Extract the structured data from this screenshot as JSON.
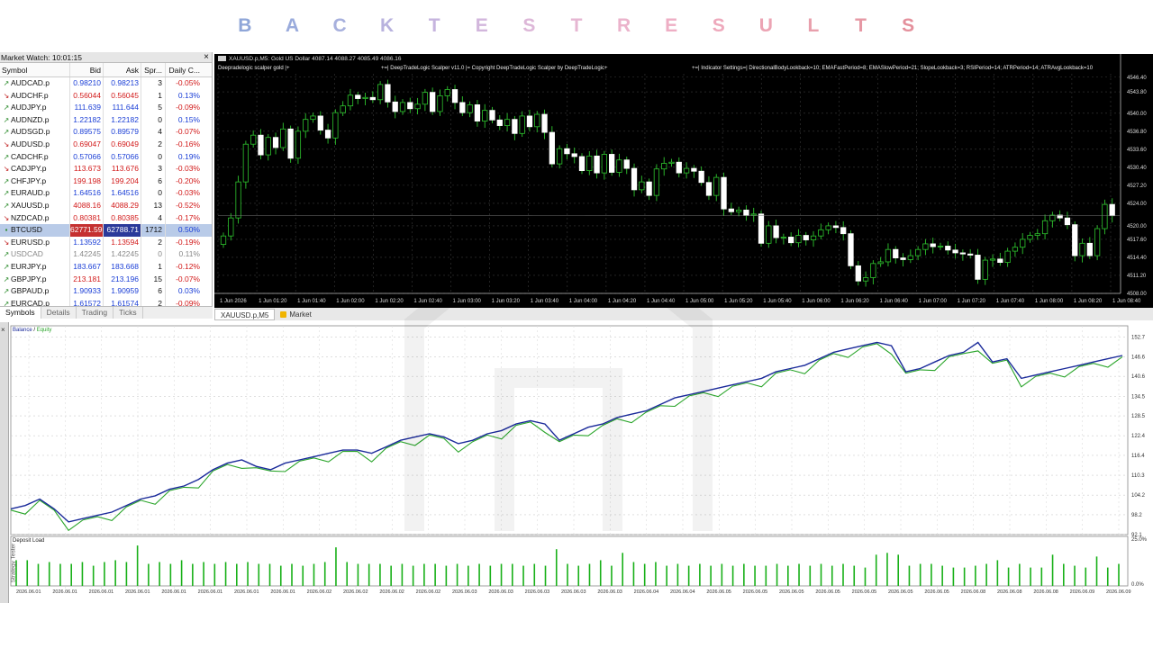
{
  "banner": {
    "letters": [
      "B",
      "A",
      "C",
      "K",
      "T",
      "E",
      "S",
      "T",
      "R",
      "E",
      "S",
      "U",
      "L",
      "T",
      "S"
    ],
    "colors": [
      "#8fa6d8",
      "#9aabdc",
      "#a7b0dd",
      "#b8b2de",
      "#c6b4de",
      "#d2b6dc",
      "#ddb7d8",
      "#e6b6d2",
      "#ebb3cb",
      "#eeaec4",
      "#eea9bc",
      "#eca4b4",
      "#e89fac",
      "#e698a4",
      "#e4909c"
    ]
  },
  "market_watch": {
    "title": "Market Watch: 10:01:15",
    "close": "×",
    "columns": [
      "Symbol",
      "Bid",
      "Ask",
      "Spr...",
      "Daily C..."
    ],
    "rows": [
      {
        "symbol": "AUDCAD.p",
        "bid": "0.98210",
        "ask": "0.98213",
        "spread": "3",
        "change": "-0.05%",
        "dir": "up",
        "bid_color": "blue",
        "ask_color": "blue",
        "change_color": "red"
      },
      {
        "symbol": "AUDCHF.p",
        "bid": "0.56044",
        "ask": "0.56045",
        "spread": "1",
        "change": "0.13%",
        "dir": "dn",
        "bid_color": "red",
        "ask_color": "red",
        "change_color": "blue"
      },
      {
        "symbol": "AUDJPY.p",
        "bid": "111.639",
        "ask": "111.644",
        "spread": "5",
        "change": "-0.09%",
        "dir": "up",
        "bid_color": "blue",
        "ask_color": "blue",
        "change_color": "red"
      },
      {
        "symbol": "AUDNZD.p",
        "bid": "1.22182",
        "ask": "1.22182",
        "spread": "0",
        "change": "0.15%",
        "dir": "up",
        "bid_color": "blue",
        "ask_color": "blue",
        "change_color": "blue"
      },
      {
        "symbol": "AUDSGD.p",
        "bid": "0.89575",
        "ask": "0.89579",
        "spread": "4",
        "change": "-0.07%",
        "dir": "up",
        "bid_color": "blue",
        "ask_color": "blue",
        "change_color": "red"
      },
      {
        "symbol": "AUDUSD.p",
        "bid": "0.69047",
        "ask": "0.69049",
        "spread": "2",
        "change": "-0.16%",
        "dir": "dn",
        "bid_color": "red",
        "ask_color": "red",
        "change_color": "red"
      },
      {
        "symbol": "CADCHF.p",
        "bid": "0.57066",
        "ask": "0.57066",
        "spread": "0",
        "change": "0.19%",
        "dir": "up",
        "bid_color": "blue",
        "ask_color": "blue",
        "change_color": "blue"
      },
      {
        "symbol": "CADJPY.p",
        "bid": "113.673",
        "ask": "113.676",
        "spread": "3",
        "change": "-0.03%",
        "dir": "dn",
        "bid_color": "red",
        "ask_color": "red",
        "change_color": "red"
      },
      {
        "symbol": "CHFJPY.p",
        "bid": "199.198",
        "ask": "199.204",
        "spread": "6",
        "change": "-0.20%",
        "dir": "up",
        "bid_color": "red",
        "ask_color": "red",
        "change_color": "red"
      },
      {
        "symbol": "EURAUD.p",
        "bid": "1.64516",
        "ask": "1.64516",
        "spread": "0",
        "change": "-0.03%",
        "dir": "up",
        "bid_color": "blue",
        "ask_color": "blue",
        "change_color": "red"
      },
      {
        "symbol": "XAUUSD.p",
        "bid": "4088.16",
        "ask": "4088.29",
        "spread": "13",
        "change": "-0.52%",
        "dir": "up",
        "bid_color": "red",
        "ask_color": "red",
        "change_color": "red"
      },
      {
        "symbol": "NZDCAD.p",
        "bid": "0.80381",
        "ask": "0.80385",
        "spread": "4",
        "change": "-0.17%",
        "dir": "dn",
        "bid_color": "red",
        "ask_color": "red",
        "change_color": "red"
      },
      {
        "symbol": "BTCUSD",
        "bid": "62771.59",
        "ask": "62788.71",
        "spread": "1712",
        "change": "0.50%",
        "dir": "sel",
        "bid_color": "red",
        "ask_color": "blue",
        "change_color": "blue",
        "selected": true
      },
      {
        "symbol": "EURUSD.p",
        "bid": "1.13592",
        "ask": "1.13594",
        "spread": "2",
        "change": "-0.19%",
        "dir": "dn",
        "bid_color": "blue",
        "ask_color": "red",
        "change_color": "red"
      },
      {
        "symbol": "USDCAD",
        "bid": "1.42245",
        "ask": "1.42245",
        "spread": "0",
        "change": "0.11%",
        "dir": "up",
        "bid_color": "blue",
        "ask_color": "blue",
        "change_color": "blue",
        "muted": true
      },
      {
        "symbol": "EURJPY.p",
        "bid": "183.667",
        "ask": "183.668",
        "spread": "1",
        "change": "-0.12%",
        "dir": "up",
        "bid_color": "blue",
        "ask_color": "blue",
        "change_color": "red"
      },
      {
        "symbol": "GBPJPY.p",
        "bid": "213.181",
        "ask": "213.196",
        "spread": "15",
        "change": "-0.07%",
        "dir": "up",
        "bid_color": "red",
        "ask_color": "blue",
        "change_color": "red"
      },
      {
        "symbol": "GBPAUD.p",
        "bid": "1.90933",
        "ask": "1.90959",
        "spread": "6",
        "change": "0.03%",
        "dir": "up",
        "bid_color": "blue",
        "ask_color": "blue",
        "change_color": "blue"
      },
      {
        "symbol": "EURCAD.p",
        "bid": "1.61572",
        "ask": "1.61574",
        "spread": "2",
        "change": "-0.09%",
        "dir": "up",
        "bid_color": "blue",
        "ask_color": "blue",
        "change_color": "red"
      }
    ],
    "tabs": [
      "Symbols",
      "Details",
      "Trading",
      "Ticks"
    ]
  },
  "chart": {
    "title": "XAUUSD.p,M5:  Gold US Dollar  4087.14 4088.27 4085.49 4086.16",
    "info_left": "Deepradelogic scalper gold |+",
    "info_mid": "+=| DeepTradeLogic Scalper v11.0 |=  Copyright DeepTradeLogic Scalper by DeepTradeLogic+",
    "info_right": "+=| Indicator Settings=| DirectionalBodyLookback=10; EMAFastPeriod=8; EMASlowPeriod=21; SlopeLookback=3; RSIPeriod=14; ATRPeriod=14; ATRAvgLookback=10",
    "price_labels": [
      "4546.40",
      "4543.80",
      "4540.00",
      "4536.80",
      "4533.60",
      "4530.40",
      "4527.20",
      "4524.00",
      "4520.00",
      "4517.60",
      "4514.40",
      "4511.20",
      "4508.00"
    ],
    "time_labels": [
      "1 Jun 2026",
      "1 Jun 01:20",
      "1 Jun 01:40",
      "1 Jun 02:00",
      "1 Jun 02:20",
      "1 Jun 02:40",
      "1 Jun 03:00",
      "1 Jun 03:20",
      "1 Jun 03:40",
      "1 Jun 04:00",
      "1 Jun 04:20",
      "1 Jun 04:40",
      "1 Jun 05:00",
      "1 Jun 05:20",
      "1 Jun 05:40",
      "1 Jun 06:00",
      "1 Jun 06:20",
      "1 Jun 06:40",
      "1 Jun 07:00",
      "1 Jun 07:20",
      "1 Jun 07:40",
      "1 Jun 08:00",
      "1 Jun 08:20",
      "1 Jun 08:40"
    ],
    "closes": [
      4518.2,
      4521.4,
      4527.8,
      4534.5,
      4536.1,
      4532.6,
      4535.7,
      4533.9,
      4537.2,
      4532.0,
      4536.8,
      4538.9,
      4539.5,
      4537.0,
      4535.6,
      4540.1,
      4541.3,
      4543.2,
      4542.6,
      4542.8,
      4542.4,
      4545.1,
      4542.0,
      4540.3,
      4541.9,
      4540.8,
      4541.6,
      4543.7,
      4540.3,
      4543.1,
      4544.2,
      4541.9,
      4540.1,
      4541.5,
      4538.6,
      4540.5,
      4538.8,
      4537.8,
      4538.9,
      4536.4,
      4539.5,
      4537.6,
      4539.8,
      4536.6,
      4531.0,
      4533.7,
      4532.8,
      4532.3,
      4529.8,
      4532.4,
      4529.4,
      4532.7,
      4529.5,
      4531.7,
      4530.2,
      4526.4,
      4527.8,
      4525.4,
      4530.1,
      4531.1,
      4531.3,
      4529.4,
      4530.2,
      4529.7,
      4527.7,
      4525.4,
      4528.6,
      4523.0,
      4522.5,
      4522.8,
      4521.9,
      4522.1,
      4516.9,
      4520.0,
      4517.9,
      4518.0,
      4517.0,
      4518.3,
      4517.5,
      4518.2,
      4519.3,
      4520.0,
      4519.7,
      4518.6,
      4512.9,
      4510.2,
      4510.8,
      4513.3,
      4513.6,
      4515.8,
      4514.3,
      4514.0,
      4514.7,
      4515.8,
      4516.8,
      4516.3,
      4516.4,
      4515.7,
      4515.2,
      4515.0,
      4514.8,
      4510.5,
      4513.9,
      4514.1,
      4513.5,
      4515.5,
      4516.2,
      4517.6,
      4518.3,
      4518.6,
      4520.9,
      4521.9,
      4521.4,
      4520.2,
      4514.7,
      4516.9,
      4514.7,
      4519.5,
      4523.8,
      4521.8
    ],
    "tabs": [
      "XAUUSD.p,M5",
      "Market"
    ]
  },
  "tester": {
    "close": "×",
    "side_label": "Strategy Tester",
    "legend_balance": "Balance",
    "legend_sep": " / ",
    "legend_equity": "Equity",
    "balance_color": "#1a2a9a",
    "equity_color": "#2aa52a",
    "y_labels": [
      "152.7",
      "146.6",
      "140.6",
      "134.5",
      "128.5",
      "122.4",
      "116.4",
      "110.3",
      "104.2",
      "98.2",
      "92.1"
    ],
    "deposit_label": "Deposit Load",
    "deposit_pct_top": "25.0%",
    "deposit_pct_bottom": "0.0%",
    "date_labels": [
      "2026.06.01",
      "2026.06.01",
      "2026.06.01",
      "2026.06.01",
      "2026.06.01",
      "2026.06.01",
      "2026.06.01",
      "2026.06.01",
      "2026.06.02",
      "2026.06.02",
      "2026.06.02",
      "2026.06.02",
      "2026.06.03",
      "2026.06.03",
      "2026.06.03",
      "2026.06.03",
      "2026.06.03",
      "2026.06.04",
      "2026.06.04",
      "2026.06.05",
      "2026.06.05",
      "2026.06.05",
      "2026.06.05",
      "2026.06.05",
      "2026.06.05",
      "2026.06.05",
      "2026.06.08",
      "2026.06.08",
      "2026.06.08",
      "2026.06.09",
      "2026.06.09"
    ],
    "balance": [
      100,
      101,
      103,
      100,
      96,
      97,
      98,
      99,
      101,
      103,
      104,
      106,
      107,
      109,
      112,
      114,
      115,
      113,
      112,
      114,
      115,
      116,
      117,
      118,
      118,
      117,
      119,
      121,
      122,
      123,
      122,
      120,
      121,
      123,
      124,
      126,
      127,
      126,
      121,
      123,
      125,
      126,
      128,
      129,
      130,
      132,
      134,
      135,
      136,
      137,
      138,
      139,
      140,
      142,
      143,
      144,
      146,
      148,
      149,
      150,
      151,
      150,
      142,
      143,
      145,
      147,
      148,
      151,
      145,
      146,
      140,
      141,
      142,
      143,
      144,
      145,
      146,
      147
    ],
    "deposit_load": [
      14,
      14,
      12,
      13,
      12,
      12,
      13,
      11,
      13,
      14,
      13,
      22,
      12,
      13,
      12,
      14,
      12,
      13,
      12,
      13,
      12,
      13,
      12,
      12,
      11,
      12,
      11,
      12,
      13,
      21,
      13,
      12,
      12,
      12,
      11,
      12,
      11,
      12,
      12,
      11,
      12,
      11,
      12,
      11,
      12,
      12,
      11,
      12,
      11,
      20,
      12,
      11,
      12,
      14,
      11,
      18,
      13,
      12,
      13,
      11,
      12,
      11,
      12,
      11,
      12,
      11,
      12,
      11,
      11,
      12,
      11,
      12,
      11,
      12,
      11,
      12,
      11,
      10,
      17,
      18,
      17,
      11,
      12,
      12,
      11,
      10,
      10,
      11,
      12,
      14,
      10,
      12,
      10,
      10,
      17,
      12,
      11,
      10,
      16,
      10,
      12
    ]
  }
}
